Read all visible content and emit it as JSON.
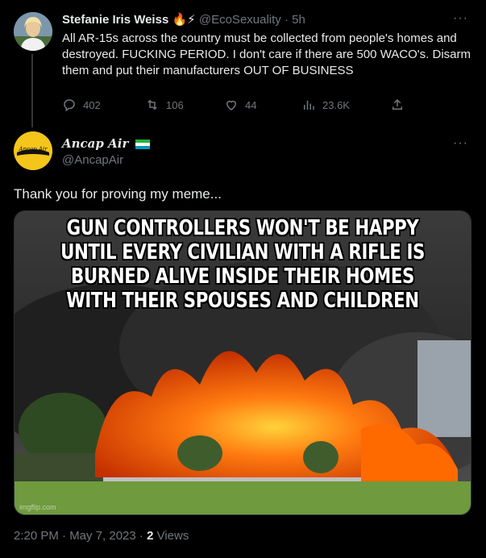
{
  "tweet1": {
    "name": "Stefanie Iris Weiss",
    "emoji": "🔥⚡",
    "handle": "@EcoSexuality",
    "time": "· 5h",
    "text": "All AR-15s across the country must be collected from people's homes and destroyed. FUCKING PERIOD. I don't care if there are 500 WACO's. Disarm them and put their manufacturers OUT OF BUSINESS",
    "replies": "402",
    "retweets": "106",
    "likes": "44",
    "views": "23.6K"
  },
  "tweet2": {
    "name": "Ancap Air",
    "handle": "@AncapAir",
    "avatar_text": "Ancap Air",
    "text": "Thank you for proving my meme...",
    "meme_caption": "GUN CONTROLLERS WON'T BE HAPPY UNTIL EVERY CIVILIAN WITH A RIFLE IS BURNED ALIVE INSIDE THEIR HOMES WITH THEIR SPOUSES AND CHILDREN",
    "watermark": "imgflip.com",
    "timestamp": "2:20 PM · May 7, 2023 ·",
    "views_count": "2",
    "views_label": "Views"
  },
  "more_label": "···",
  "colors": {
    "background": "#000000",
    "text": "#e7e9ea",
    "muted": "#71767b",
    "fire": "#ff6a00"
  }
}
